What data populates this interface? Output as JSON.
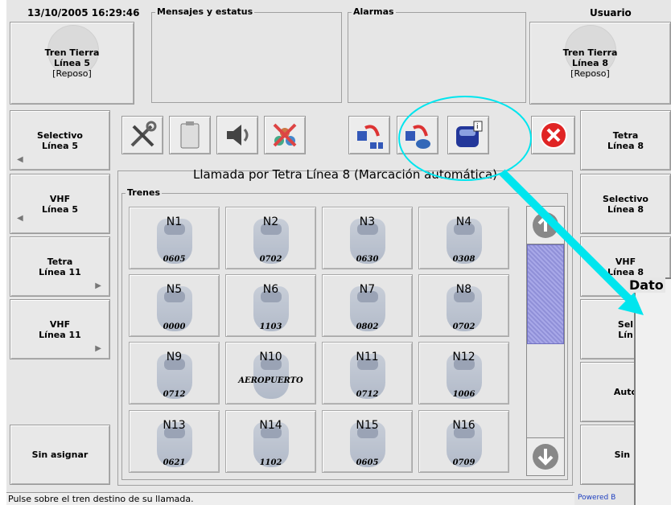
{
  "header": {
    "datetime": "13/10/2005  16:29:46",
    "messages_title": "Mensajes y estatus",
    "alarms_title": "Alarmas",
    "user_title": "Usuario"
  },
  "left_status": {
    "line1": "Tren Tierra",
    "line2": "Línea 5",
    "line3": "[Reposo]"
  },
  "right_status": {
    "line1": "Tren Tierra",
    "line2": "Línea 8",
    "line3": "[Reposo]"
  },
  "left_buttons": [
    {
      "l1": "Selectivo",
      "l2": "Línea 5"
    },
    {
      "l1": "VHF",
      "l2": "Línea 5"
    },
    {
      "l1": "Tetra",
      "l2": "Línea 11"
    },
    {
      "l1": "VHF",
      "l2": "Línea 11"
    },
    {
      "l1": "",
      "l2": ""
    },
    {
      "l1": "Sin asignar",
      "l2": ""
    }
  ],
  "right_buttons": [
    {
      "l1": "Tetra",
      "l2": "Línea 8"
    },
    {
      "l1": "Selectivo",
      "l2": "Línea 8"
    },
    {
      "l1": "VHF",
      "l2": "Línea 8"
    },
    {
      "l1": "Sel",
      "l2": "Lín"
    },
    {
      "l1": "Auto",
      "l2": ""
    },
    {
      "l1": "Sin :",
      "l2": ""
    }
  ],
  "call_title": "Llamada por Tetra Línea 8 (Marcación automática)",
  "trains_title": "Trenes",
  "trains": [
    {
      "name": "N1",
      "num": "0605"
    },
    {
      "name": "N2",
      "num": "0702"
    },
    {
      "name": "N3",
      "num": "0630"
    },
    {
      "name": "N4",
      "num": "0308"
    },
    {
      "name": "N5",
      "num": "0000"
    },
    {
      "name": "N6",
      "num": "1103"
    },
    {
      "name": "N7",
      "num": "0802"
    },
    {
      "name": "N8",
      "num": "0702"
    },
    {
      "name": "N9",
      "num": "0712"
    },
    {
      "name": "N10",
      "num": "",
      "mid": "AEROPUERTO"
    },
    {
      "name": "N11",
      "num": "0712"
    },
    {
      "name": "N12",
      "num": "1006"
    },
    {
      "name": "N13",
      "num": "0621"
    },
    {
      "name": "N14",
      "num": "1102"
    },
    {
      "name": "N15",
      "num": "0605"
    },
    {
      "name": "N16",
      "num": "0709"
    }
  ],
  "datos_label": "Dato",
  "status_bar": "Pulse sobre el tren destino de su llamada.",
  "powered": "Powered B",
  "colors": {
    "highlight": "#00e5ee",
    "close": "#e02424",
    "scroll_thumb": "#9c9ce0"
  }
}
